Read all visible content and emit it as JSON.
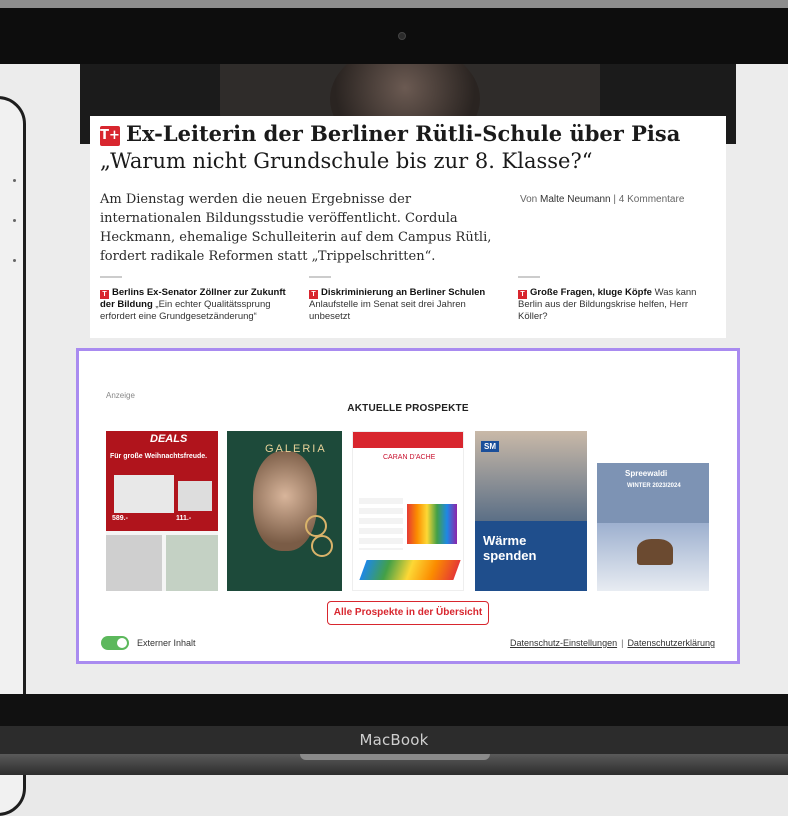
{
  "device": {
    "brand_label": "MacBook"
  },
  "article": {
    "headline_bold": "Ex-Leiterin der Berliner Rütli-Schule über Pisa",
    "headline_quote": "„Warum nicht Grundschule bis zur 8. Klasse?“",
    "teaser": "Am Dienstag werden die neuen Ergebnisse der internationalen Bildungsstudie veröffentlicht. Cordula Heckmann, ehemalige Schulleiterin auf dem Campus Rütli, fordert radikale Reformen statt „Trippelschritten“.",
    "author_prefix": "Von",
    "author_name": "Malte Neumann",
    "comments": "4 Kommentare",
    "related": [
      {
        "bold": "Berlins Ex-Senator Zöllner zur Zukunft der Bildung",
        "text": "„Ein echter Qualitätssprung erfordert eine Grundgesetzänderung“"
      },
      {
        "bold": "Diskriminierung an Berliner Schulen",
        "text": "Anlaufstelle im Senat seit drei Jahren unbesetzt"
      },
      {
        "bold": "Große Fragen, kluge Köpfe",
        "text": "Was kann Berlin aus der Bildungskrise helfen, Herr Köller?"
      }
    ]
  },
  "ad": {
    "label": "Anzeige",
    "title": "AKTUELLE PROSPEKTE",
    "prospekte": [
      {
        "brand": "DEALS",
        "slogan": "Für große Weihnachtsfreude.",
        "price1": "589.-",
        "price2": "111.-"
      },
      {
        "brand": "GALERIA"
      },
      {
        "brand": "CARAN D'ACHE"
      },
      {
        "brand": "SM",
        "slogan": "Wärme spenden"
      },
      {
        "brand": "Spreewaldi",
        "season": "WINTER 2023/2024"
      }
    ],
    "all_button": "Alle Prospekte in der Übersicht",
    "toggle_label": "Externer Inhalt",
    "privacy_settings": "Datenschutz-Einstellungen",
    "privacy_policy": "Datenschutzerklärung",
    "toggle_on": true
  },
  "colors": {
    "accent": "#d8262e",
    "toggle": "#5cb85c",
    "frame": "#a98bf0"
  }
}
